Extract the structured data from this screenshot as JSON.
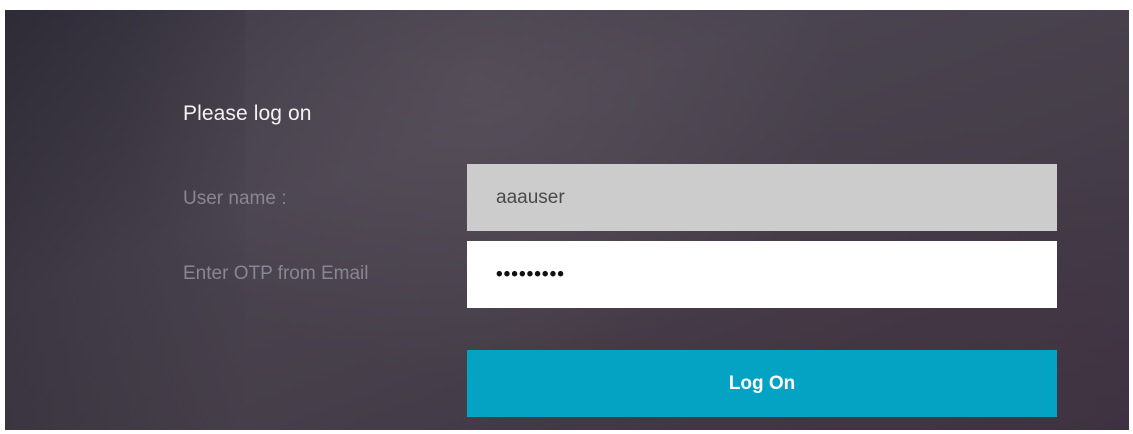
{
  "form": {
    "heading": "Please log on",
    "username_label": "User name :",
    "username_value": "aaauser",
    "otp_label": "Enter OTP from Email",
    "otp_value": "•••••••••",
    "submit_label": "Log On"
  },
  "colors": {
    "background": "#46404c",
    "username_field": "#cccccc",
    "otp_field": "#ffffff",
    "button": "#04a3c4",
    "label_text": "#8a8593"
  }
}
